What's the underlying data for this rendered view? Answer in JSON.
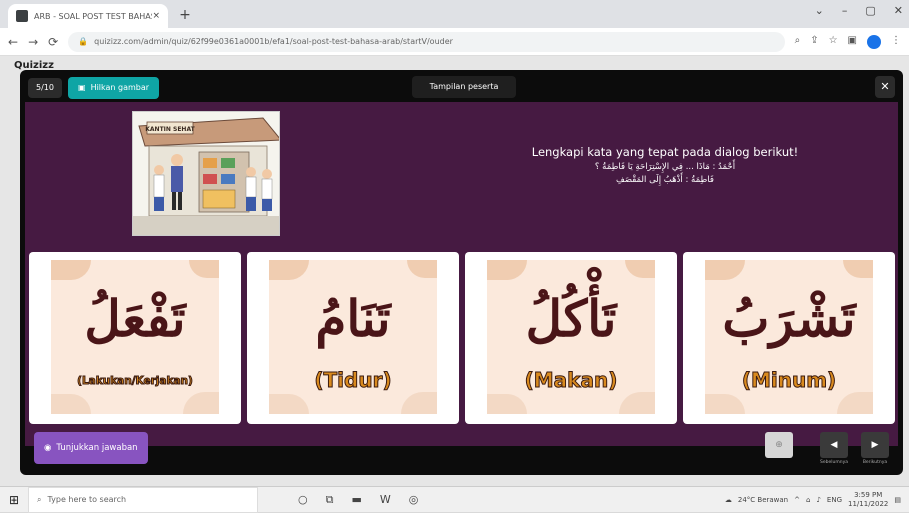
{
  "browser": {
    "tab_title": "ARB - SOAL POST TEST BAHASA",
    "tab_close": "×",
    "new_tab": "+",
    "url": "quizizz.com/admin/quiz/62f99e0361a0001b/efa1/soal-post-test-bahasa-arab/startV/ouder",
    "window_controls": [
      "⌄",
      "–",
      "▢",
      "✕"
    ]
  },
  "page": {
    "logo": "Quizizz"
  },
  "modal": {
    "question_count": "5/10",
    "hide_button": "Hilkan gambar",
    "preview_button": "Tampilan peserta",
    "close": "✕",
    "question_text": "Lengkapi kata yang tepat pada dialog berikut!",
    "dialog_line1": "أَحْمَدُ : مَاذَا ... فِي الإِسْتِرَاحَةِ يَا فَاطِمَةُ ؟",
    "dialog_line2": "فَاطِمَةُ : أَذْهَبُ إِلَى المَقْصَفِ",
    "canteen_sign": "KANTIN SEHAT",
    "options": [
      {
        "arabic": "تَفْعَلُ",
        "latin": "(Lakukan/Kerjakan)"
      },
      {
        "arabic": "تَنَامُ",
        "latin": "(Tidur)"
      },
      {
        "arabic": "تَأْكُلُ",
        "latin": "(Makan)"
      },
      {
        "arabic": "تَشْرَبُ",
        "latin": "(Minum)"
      }
    ],
    "show_answer_button": "Tunjukkan jawaban",
    "zoom_icon": "⊕",
    "prev_label": "Sebelumnya",
    "next_label": "Berikutnya"
  },
  "taskbar": {
    "search_placeholder": "Type here to search",
    "weather": "24°C Berawan",
    "time": "3:59 PM",
    "date": "11/11/2022",
    "lang": "ENG"
  },
  "colors": {
    "accent_teal": "#0fa5a5",
    "question_bg": "#461a42",
    "answer_button": "#8854c0",
    "card_bg": "#fbe9dc"
  }
}
